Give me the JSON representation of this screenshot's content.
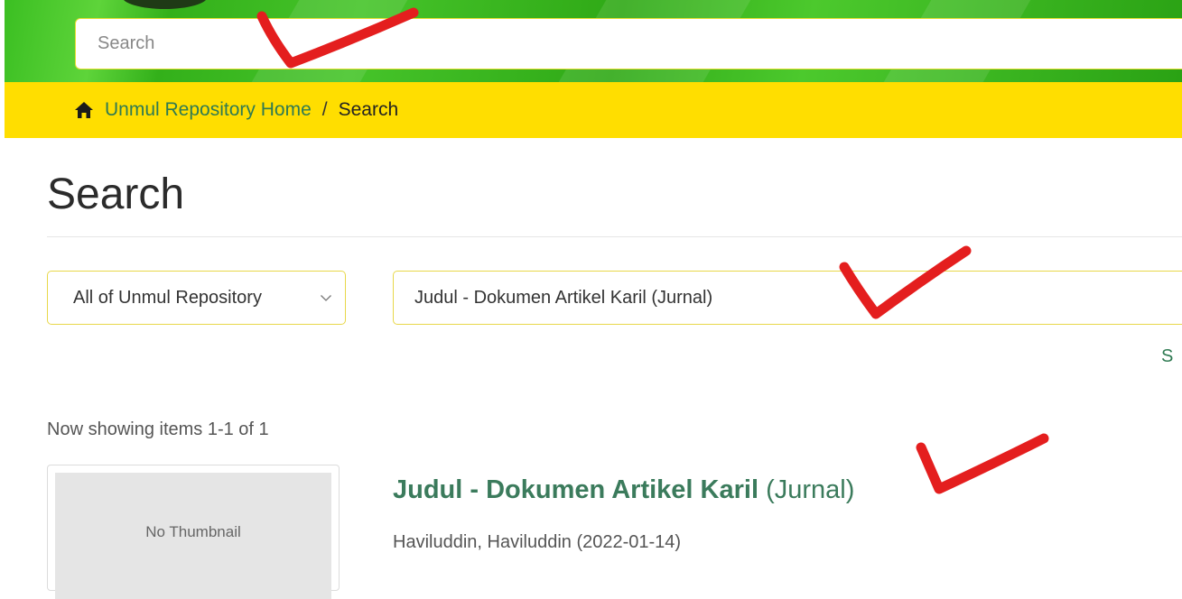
{
  "header": {
    "search_placeholder": "Search"
  },
  "breadcrumb": {
    "home_label": "Unmul Repository Home",
    "separator": "/",
    "current": "Search"
  },
  "page": {
    "title": "Search"
  },
  "filters": {
    "scope_value": "All of Unmul Repository",
    "query_value": "Judul - Dokumen Artikel Karil (Jurnal)",
    "cut_link_text": "S"
  },
  "results": {
    "showing_text": "Now showing items 1-1 of 1",
    "items": [
      {
        "thumbnail_text": "No Thumbnail",
        "title_main": "Judul - Dokumen Artikel Karil ",
        "title_paren": "(Jurnal)",
        "meta": "Haviluddin, Haviluddin (2022-01-14)"
      }
    ]
  },
  "colors": {
    "header_green": "#3bbf22",
    "breadcrumb_yellow": "#ffde00",
    "link_green": "#2f7a52",
    "annotation_red": "#e41e1e"
  },
  "icons": {
    "home": "home-icon",
    "dropdown": "chevron-down-icon"
  }
}
